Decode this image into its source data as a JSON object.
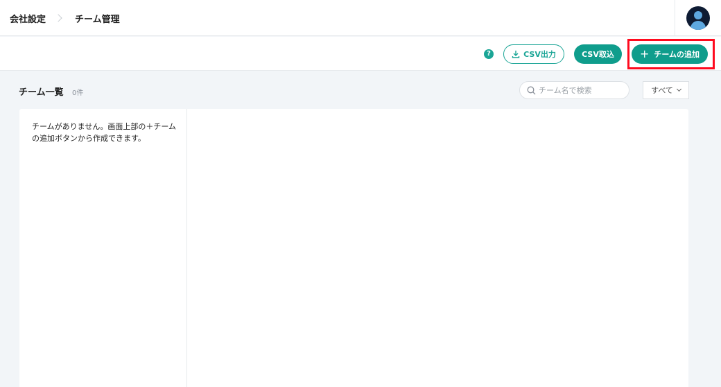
{
  "header": {
    "breadcrumb": [
      "会社設定",
      "チーム管理"
    ]
  },
  "toolbar": {
    "help_label": "?",
    "csv_export_label": "CSV出力",
    "csv_import_label": "CSV取込",
    "add_team_label": "チームの追加"
  },
  "list": {
    "title": "チーム一覧",
    "count": "0件",
    "search_placeholder": "チーム名で検索",
    "filter_label": "すべて"
  },
  "empty": {
    "message": "チームがありません。画面上部の＋チームの追加ボタンから作成できます。"
  },
  "colors": {
    "accent": "#0f9d8c",
    "highlight": "#ff0a1e",
    "avatar_bg": "#0e1b33"
  }
}
